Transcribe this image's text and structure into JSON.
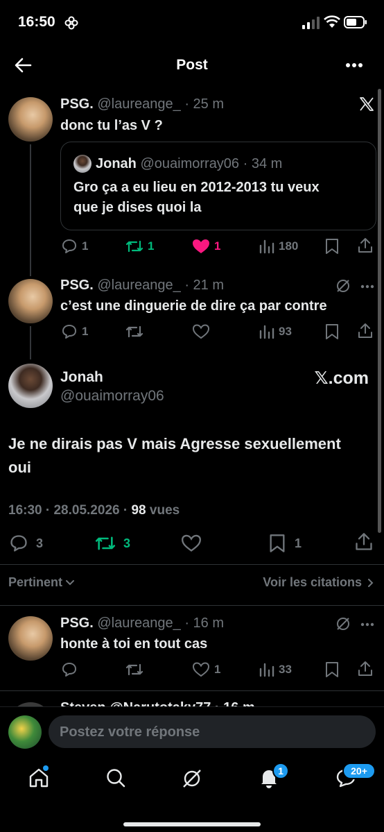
{
  "status_bar": {
    "time": "16:50"
  },
  "header": {
    "title": "Post"
  },
  "reply1": {
    "name": "PSG.",
    "handle": "@laureange_",
    "time": "· 25 m",
    "text": "donc tu l’as V ?",
    "quote": {
      "name": "Jonah",
      "handle": "@ouaimorray06",
      "time": "· 34 m",
      "text_line1": "Gro ça a eu lieu en 2012-2013 tu veux",
      "text_line2": "que je dises quoi la"
    },
    "replies": "1",
    "reposts": "1",
    "likes": "1",
    "views": "180"
  },
  "reply2": {
    "name": "PSG.",
    "handle": "@laureange_",
    "time": "· 21 m",
    "text": "c’est une dinguerie de dire ça par contre",
    "replies": "1",
    "views": "93"
  },
  "main_post": {
    "name": "Jonah",
    "handle": "@ouaimorray06",
    "source": "𝕏.com",
    "text_line1": "Je ne dirais pas V mais Agresse sexuellement",
    "text_line2": "oui",
    "time": "16:30 · 28.05.2026 ·",
    "views_count": "98",
    "views_label": "vues",
    "replies": "3",
    "reposts": "3",
    "bookmarks": "1"
  },
  "sort": {
    "label": "Pertinent",
    "quotes_link": "Voir les citations"
  },
  "reply3": {
    "name": "PSG.",
    "handle": "@laureange_",
    "time": "· 16 m",
    "text": "honte à toi en tout cas",
    "likes": "1",
    "views": "33"
  },
  "reply4_partial": {
    "text": "Steven @Narutotaky77 · 16 m"
  },
  "composer": {
    "placeholder": "Postez votre réponse"
  },
  "tabbar": {
    "notifications_badge": "1",
    "messages_badge": "20+"
  },
  "colors": {
    "background": "#000000",
    "muted": "#71767b",
    "like": "#f91880",
    "repost": "#00ba7c",
    "accent": "#1d9bf0"
  }
}
